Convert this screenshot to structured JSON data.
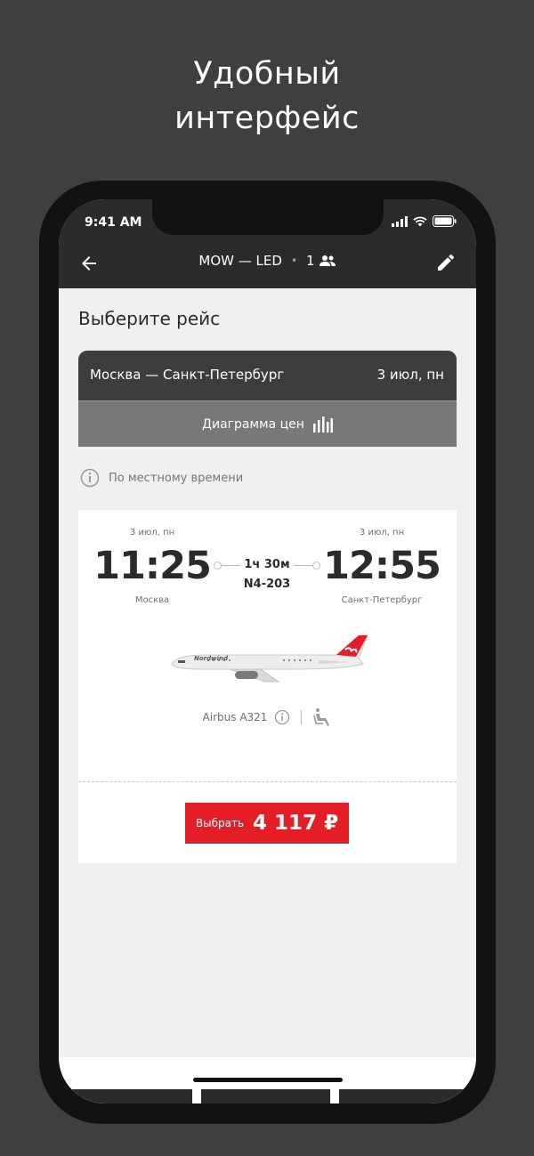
{
  "headline": {
    "line1": "Удобный",
    "line2": "интерфейс"
  },
  "status_bar": {
    "time": "9:41 AM"
  },
  "nav": {
    "route": "MOW — LED",
    "dot": "•",
    "passengers": "1"
  },
  "page_title": "Выберите рейс",
  "route_card": {
    "route": "Москва — Санкт-Петербург",
    "date": "3 июл, пн"
  },
  "price_chart_label": "Диаграмма цен",
  "local_time_note": "По местному времени",
  "flight": {
    "dep_date": "3 июл, пн",
    "arr_date": "3 июл, пн",
    "dep_time": "11:25",
    "arr_time": "12:55",
    "dep_city": "Москва",
    "arr_city": "Санкт-Петербург",
    "duration": "1ч 30м",
    "flight_number": "N4-203",
    "aircraft": "Airbus A321",
    "airline_logo_text": "Nordwind"
  },
  "select_button": {
    "label": "Выбрать",
    "price": "4 117 ₽"
  },
  "colors": {
    "accent": "#e41e26",
    "dark": "#2b2b2b",
    "background": "#3f3f3f"
  },
  "icons": [
    "back-arrow-icon",
    "passengers-icon",
    "edit-pencil-icon",
    "bar-chart-icon",
    "info-icon",
    "seat-icon",
    "signal-icon",
    "wifi-icon",
    "battery-icon"
  ]
}
